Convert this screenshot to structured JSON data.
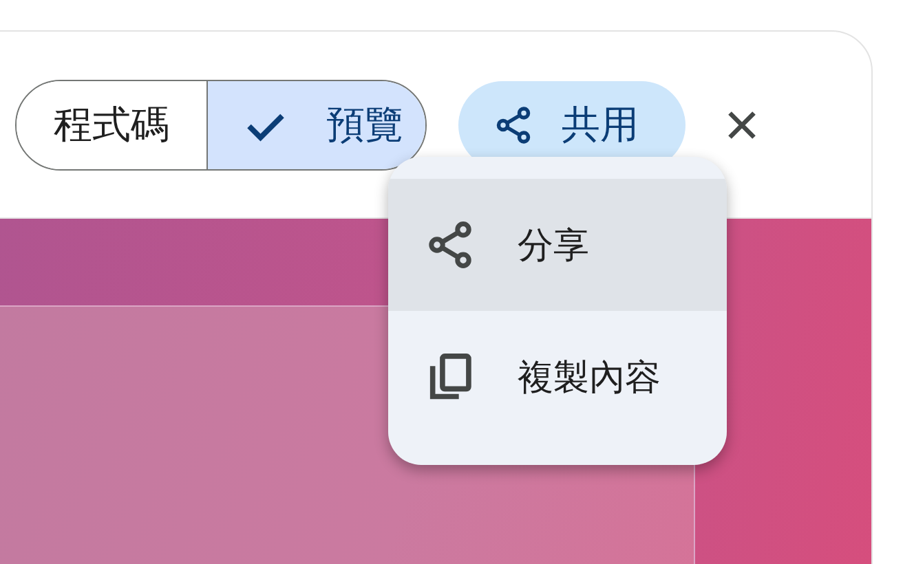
{
  "view_toggle": [
    {
      "label": "程式碼",
      "selected": false
    },
    {
      "label": "預覽",
      "selected": true
    }
  ],
  "share_button": {
    "label": "共用"
  },
  "share_menu": [
    {
      "label": "分享",
      "kind": "share",
      "selected": true
    },
    {
      "label": "複製內容",
      "kind": "copy",
      "selected": false
    }
  ]
}
